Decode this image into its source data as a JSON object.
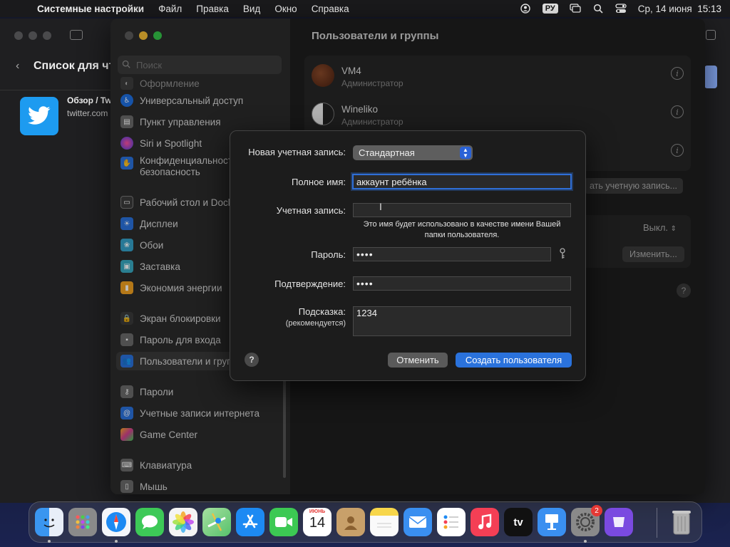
{
  "menubar": {
    "app_name": "Системные настройки",
    "items": [
      "Файл",
      "Правка",
      "Вид",
      "Окно",
      "Справка"
    ],
    "keyboard_layout": "РУ",
    "datetime": "Ср, 14 июня  15:13"
  },
  "background_window": {
    "title": "Список для чт",
    "item_title": "Обзор / Tw",
    "item_url": "twitter.com"
  },
  "sidebar": {
    "search_placeholder": "Поиск",
    "items": [
      {
        "label": "Оформление",
        "icon": "appearance-icon",
        "color": "#4a4a4a"
      },
      {
        "label": "Универсальный доступ",
        "icon": "accessibility-icon",
        "color": "#1e6fe0"
      },
      {
        "label": "Пункт управления",
        "icon": "control-center-icon",
        "color": "#6a6a6a"
      },
      {
        "label": "Siri и Spotlight",
        "icon": "siri-icon",
        "color": "#b040c0"
      },
      {
        "label": "Конфиденциальность и",
        "label2": "безопасность",
        "icon": "privacy-hand-icon",
        "color": "#2a72dc"
      },
      {
        "label": "Рабочий стол и Dock",
        "icon": "desktop-dock-icon",
        "color": "#3a3a3a"
      },
      {
        "label": "Дисплеи",
        "icon": "displays-icon",
        "color": "#2a72dc"
      },
      {
        "label": "Обои",
        "icon": "wallpaper-icon",
        "color": "#35a0c8"
      },
      {
        "label": "Заставка",
        "icon": "screensaver-icon",
        "color": "#38a8c0"
      },
      {
        "label": "Экономия энергии",
        "icon": "battery-icon",
        "color": "#f0a020"
      },
      {
        "label": "Экран блокировки",
        "icon": "lock-screen-icon",
        "color": "#3a3a3a"
      },
      {
        "label": "Пароль для входа",
        "icon": "login-password-icon",
        "color": "#6a6a6a"
      },
      {
        "label": "Пользователи и группы",
        "icon": "users-groups-icon",
        "color": "#2a72dc"
      },
      {
        "label": "Пароли",
        "icon": "key-icon",
        "color": "#6a6a6a"
      },
      {
        "label": "Учетные записи интернета",
        "icon": "internet-accounts-icon",
        "color": "#2a72dc"
      },
      {
        "label": "Game Center",
        "icon": "game-center-icon",
        "color": "#d04090"
      },
      {
        "label": "Клавиатура",
        "icon": "keyboard-icon",
        "color": "#6a6a6a"
      },
      {
        "label": "Мышь",
        "icon": "mouse-icon",
        "color": "#6a6a6a"
      }
    ]
  },
  "pane": {
    "title": "Пользователи и группы",
    "users": [
      {
        "name": "VM4",
        "role": "Администратор"
      },
      {
        "name": "Wineliko",
        "role": "Администратор"
      }
    ],
    "add_account_label": "ать учетную запись...",
    "guest_value": "Выкл.",
    "change_label": "Изменить...",
    "help": "?"
  },
  "sheet": {
    "new_account_label": "Новая учетная запись:",
    "account_type": "Стандартная",
    "full_name_label": "Полное имя:",
    "full_name_value": "аккаунт ребёнка",
    "account_name_label": "Учетная запись:",
    "account_name_value": "",
    "account_note": "Это имя будет использовано в качестве имени Вашей папки пользователя.",
    "password_label": "Пароль:",
    "password_value": "••••",
    "verify_label": "Подтверждение:",
    "verify_value": "••••",
    "hint_label": "Подсказка:",
    "hint_sub_label": "(рекомендуется)",
    "hint_value": "1234",
    "help": "?",
    "cancel_label": "Отменить",
    "create_label": "Создать пользователя"
  },
  "dock": {
    "calendar_month": "ИЮНЬ",
    "calendar_day": "14",
    "settings_badge": "2",
    "apple_tv_label": "tv",
    "apps": [
      {
        "name": "finder-icon",
        "color": "#2f8ae8"
      },
      {
        "name": "launchpad-icon",
        "color": "#8a8a8a"
      },
      {
        "name": "safari-icon",
        "color": "#f4f6fa"
      },
      {
        "name": "messages-icon",
        "color": "#3dc957"
      },
      {
        "name": "photos-icon",
        "color": "#f4f4f4"
      },
      {
        "name": "maps-icon",
        "color": "#57c26c"
      },
      {
        "name": "app-store-icon",
        "color": "#1d8af3"
      },
      {
        "name": "facetime-icon",
        "color": "#3cc953"
      },
      {
        "name": "calendar-icon",
        "color": "#ffffff"
      },
      {
        "name": "contacts-icon",
        "color": "#c8a06a"
      },
      {
        "name": "notes-icon",
        "color": "#f7d64a"
      },
      {
        "name": "mail-icon",
        "color": "#3a8ff0"
      },
      {
        "name": "reminders-icon",
        "color": "#ffffff"
      },
      {
        "name": "music-icon",
        "color": "#f43f55"
      },
      {
        "name": "apple-tv-icon",
        "color": "#111111"
      },
      {
        "name": "keynote-icon",
        "color": "#3a8ff0"
      },
      {
        "name": "system-settings-icon",
        "color": "#8a8a8a"
      },
      {
        "name": "podcasts-icon",
        "color": "#7a4ae0"
      },
      {
        "name": "trash-icon",
        "color": "#a0a0a0"
      }
    ]
  }
}
